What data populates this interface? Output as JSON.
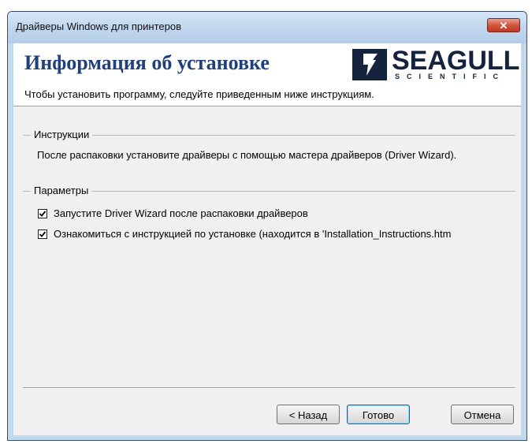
{
  "window": {
    "title": "Драйверы Windows для принтеров",
    "close_glyph": "✕"
  },
  "header": {
    "title": "Информация об установке",
    "subtitle": "Чтобы установить программу, следуйте приведенным ниже инструкциям.",
    "logo": {
      "name": "SEAGULL",
      "sub": "SCIENTIFIC",
      "color": "#15233f"
    }
  },
  "instructions": {
    "label": "Инструкции",
    "text": "После распаковки установите драйверы с помощью мастера драйверов (Driver Wizard)."
  },
  "parameters": {
    "label": "Параметры",
    "options": [
      {
        "label": "Запустите Driver Wizard после распаковки драйверов",
        "checked": true
      },
      {
        "label": "Ознакомиться с инструкцией по установке (находится в 'Installation_Instructions.htm",
        "checked": true
      }
    ]
  },
  "buttons": {
    "back": "< Назад",
    "finish": "Готово",
    "cancel": "Отмена"
  },
  "colors": {
    "title_text": "#1f3f7d",
    "close_button": "#c13a24",
    "frame": "#c4d8ec"
  }
}
